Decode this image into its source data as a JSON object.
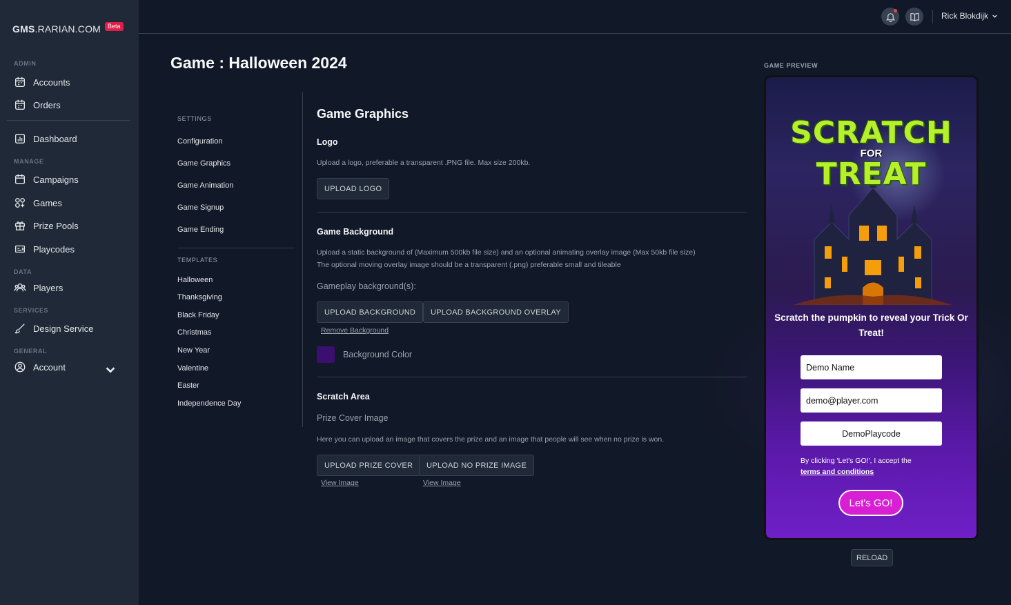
{
  "brand": {
    "name_bold": "GMS",
    "name_rest": ".RARIAN.COM",
    "badge": "Beta"
  },
  "sidebar": {
    "sections": {
      "admin": "ADMIN",
      "manage": "MANAGE",
      "data": "DATA",
      "services": "SERVICES",
      "general": "GENERAL"
    },
    "items": {
      "accounts": "Accounts",
      "orders": "Orders",
      "dashboard": "Dashboard",
      "campaigns": "Campaigns",
      "games": "Games",
      "prize_pools": "Prize Pools",
      "playcodes": "Playcodes",
      "players": "Players",
      "design_service": "Design Service",
      "account": "Account"
    }
  },
  "topbar": {
    "user_name": "Rick Blokdijk"
  },
  "page": {
    "title": "Game : Halloween 2024"
  },
  "subnav": {
    "settings_label": "SETTINGS",
    "settings": [
      "Configuration",
      "Game Graphics",
      "Game Animation",
      "Game Signup",
      "Game Ending"
    ],
    "templates_label": "TEMPLATES",
    "templates": [
      "Halloween",
      "Thanksgiving",
      "Black Friday",
      "Christmas",
      "New Year",
      "Valentine",
      "Easter",
      "Independence Day"
    ]
  },
  "content": {
    "heading": "Game Graphics",
    "logo": {
      "title": "Logo",
      "help": "Upload a logo, preferable a transparent .PNG file. Max size 200kb.",
      "upload_button": "UPLOAD LOGO"
    },
    "background": {
      "title": "Game Background",
      "help_line1": "Upload a static background of (Maximum 500kb file size) and an optional animating overlay image (Max 50kb file size)",
      "help_line2": "The optional moving overlay image should be a transparent (.png) preferable small and tileable",
      "gameplay_label": "Gameplay background(s):",
      "upload_background": "UPLOAD BACKGROUND",
      "upload_overlay": "UPLOAD BACKGROUND OVERLAY",
      "remove_link": "Remove Background",
      "color_label": "Background Color",
      "color_value": "#3b0f6e"
    },
    "scratch": {
      "title": "Scratch Area",
      "prize_cover_label": "Prize Cover Image",
      "help": "Here you can upload an image that covers the prize and an image that people will see when no prize is won.",
      "upload_prize_cover": "UPLOAD PRIZE COVER",
      "upload_no_prize": "UPLOAD NO PRIZE IMAGE",
      "view_image_1": "View Image",
      "view_image_2": "View Image"
    }
  },
  "preview": {
    "label": "GAME PREVIEW",
    "logo_line1": "SCRATCH",
    "logo_for": "FOR",
    "logo_line2": "TREAT",
    "instruction": "Scratch the pumpkin to reveal your Trick Or Treat!",
    "name_value": "Demo Name",
    "email_value": "demo@player.com",
    "playcode_value": "DemoPlaycode",
    "terms_prefix": "By clicking 'Let's GO!', I accept the",
    "terms_link": "terms and conditions",
    "go_button": "Let's GO!",
    "reload_button": "RELOAD"
  },
  "colors": {
    "sidebar_bg": "#1f2937",
    "page_bg": "#111827",
    "accent_button": "#d91fd3",
    "beta_badge": "#e11d48"
  }
}
